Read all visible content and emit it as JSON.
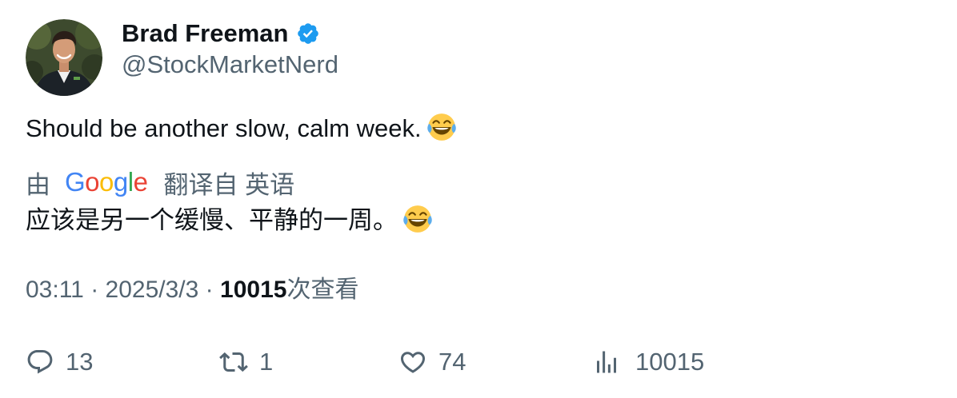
{
  "author": {
    "display_name": "Brad Freeman",
    "handle": "@StockMarketNerd",
    "verified": true
  },
  "tweet": {
    "text": "Should be another slow, calm week.",
    "emoji": "face-with-tears-of-joy"
  },
  "translation": {
    "by_label": "由",
    "provider": "Google",
    "from_label": "翻译自 英语",
    "text": "应该是另一个缓慢、平静的一周。"
  },
  "meta": {
    "time": "03:11",
    "separator": "·",
    "date": "2025/3/3",
    "views_count": "10015",
    "views_label": "次查看"
  },
  "actions": {
    "reply_count": "13",
    "retweet_count": "1",
    "like_count": "74",
    "views_count": "10015"
  },
  "colors": {
    "primary_text": "#0f1419",
    "secondary_text": "#536471",
    "verified_blue": "#1d9bf0"
  }
}
